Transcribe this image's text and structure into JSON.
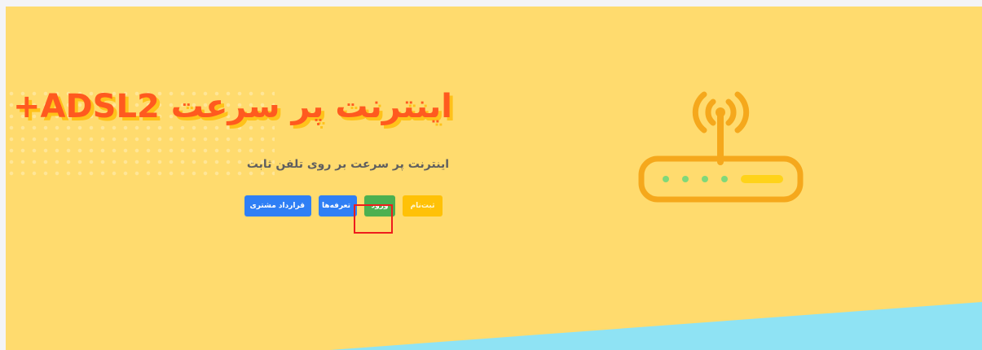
{
  "hero": {
    "title": "اینترنت پر سرعت ADSL2+",
    "subtitle": "اینترنت پر سرعت بر روی تلفن ثابت",
    "buttons": {
      "register": "ثبت‌نام",
      "login": "ورود",
      "tariffs": "تعرفه‌ها",
      "contract": "قرارداد مشتری"
    },
    "router_icon": "wifi-router-icon",
    "colors": {
      "background": "#ffdb6e",
      "title": "#ff5a1f",
      "title_shadow": "#ffc21a",
      "router": "#f5a81c",
      "router_lights": "#7fd87a",
      "router_bar": "#ffd31a",
      "wave": "#8fe3f4",
      "register_button": "#ffc107",
      "login_button": "#4cb050",
      "blue_buttons": "#2f7ff5"
    }
  }
}
